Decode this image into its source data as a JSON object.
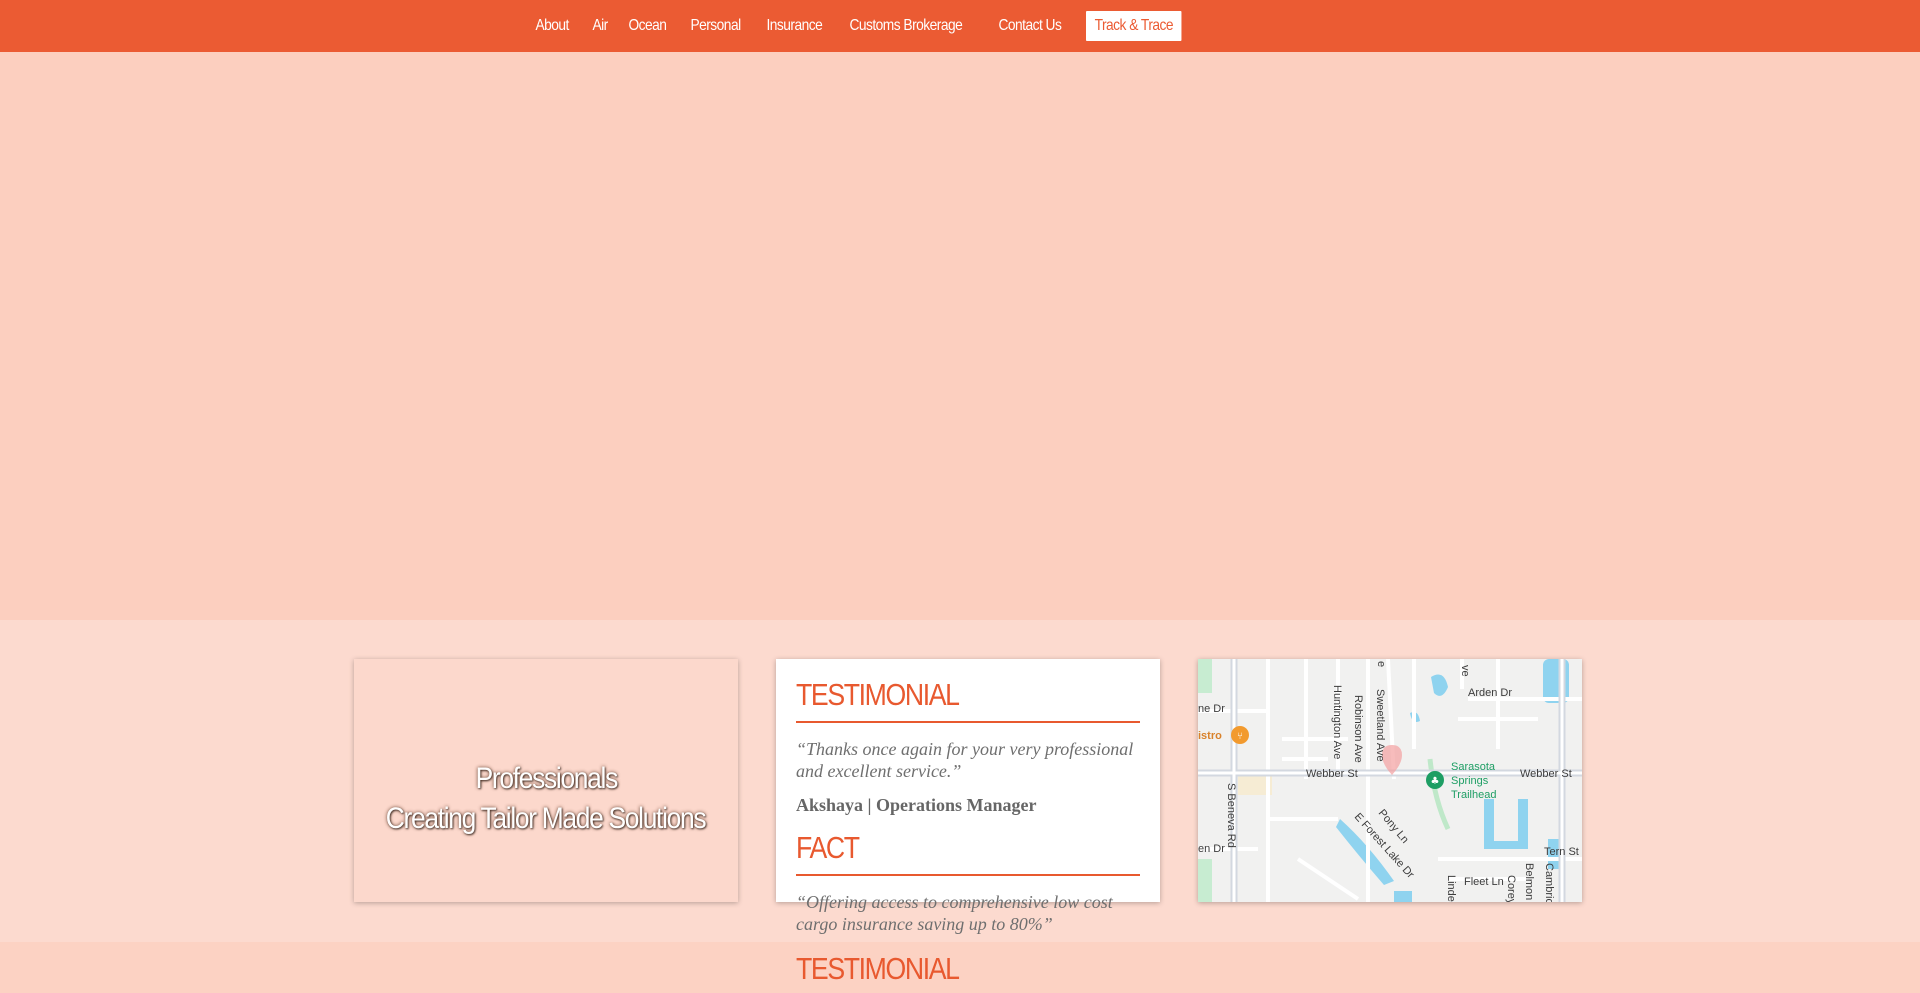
{
  "nav": {
    "items": [
      "About",
      "Air",
      "Ocean",
      "Personal",
      "Insurance",
      "Customs Brokerage",
      "Contact Us"
    ],
    "track_label": "Track & Trace"
  },
  "promo": {
    "line1": "Professionals",
    "line2": "Creating Tailor Made Solutions"
  },
  "testimonial": {
    "heading": "TESTIMONIAL",
    "quote": "“Thanks once again for your very professional and excellent service.”",
    "author": "Akshaya | Operations Manager"
  },
  "fact": {
    "heading": "FACT",
    "quote": "“Offering access to comprehensive low cost cargo insurance saving up to 80%”"
  },
  "next_heading": "TESTIMONIAL",
  "map": {
    "labels": {
      "arden": "Arden Dr",
      "ne_dr": "ne Dr",
      "bistro": "istro",
      "webber_w": "Webber St",
      "webber_e": "Webber St",
      "trailhead1": "Sarasota",
      "trailhead2": "Springs",
      "trailhead3": "Trailhead",
      "beneva": "S Beneva Rd",
      "huntington": "Huntington Ave",
      "robinson": "Robinson Ave",
      "sweetland": "Sweetland Ave",
      "pony": "Pony Ln",
      "forest": "E Forest Lake Dr",
      "en_dr": "en Dr",
      "tern": "Tern St",
      "fleet": "Fleet Ln",
      "linden": "Linde",
      "corey": "Corey",
      "belmont": "Belmon",
      "cambridge": "Cambric",
      "ave_top": "ve",
      "e_top": "e"
    },
    "colors": {
      "water": "#8fd3ef",
      "park": "#c7ecd1",
      "road": "#ffffff",
      "major_road": "#d3d8e0",
      "restaurant": "#f29a2e",
      "trail": "#1e9e64"
    }
  },
  "colors": {
    "brand": "#eb5b33",
    "hero": "#fccfbf",
    "accent": "#e8592f"
  }
}
